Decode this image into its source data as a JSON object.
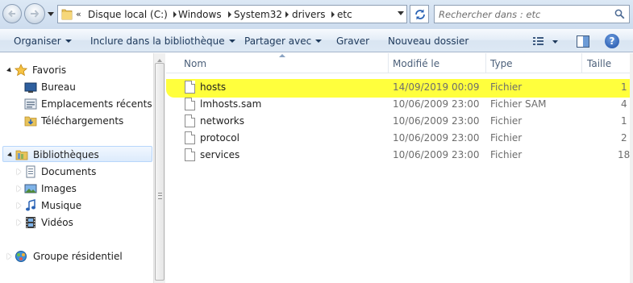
{
  "address": {
    "overflow": "«",
    "crumbs": [
      "Disque local (C:)",
      "Windows",
      "System32",
      "drivers",
      "etc"
    ]
  },
  "search": {
    "placeholder": "Rechercher dans : etc"
  },
  "toolbar": {
    "organize": "Organiser",
    "include": "Inclure dans la bibliothèque",
    "share": "Partager avec",
    "burn": "Graver",
    "new_folder": "Nouveau dossier",
    "help": "?"
  },
  "nav": {
    "favorites": "Favoris",
    "desktop": "Bureau",
    "recent": "Emplacements récents",
    "downloads": "Téléchargements",
    "libraries": "Bibliothèques",
    "documents": "Documents",
    "images": "Images",
    "music": "Musique",
    "videos": "Vidéos",
    "homegroup": "Groupe résidentiel"
  },
  "columns": {
    "name": "Nom",
    "modified": "Modifié le",
    "type": "Type",
    "size": "Taille"
  },
  "files": [
    {
      "name": "hosts",
      "modified": "14/09/2019 00:09",
      "type": "Fichier",
      "size": "1"
    },
    {
      "name": "lmhosts.sam",
      "modified": "10/06/2009 23:00",
      "type": "Fichier SAM",
      "size": "4"
    },
    {
      "name": "networks",
      "modified": "10/06/2009 23:00",
      "type": "Fichier",
      "size": "1"
    },
    {
      "name": "protocol",
      "modified": "10/06/2009 23:00",
      "type": "Fichier",
      "size": "2"
    },
    {
      "name": "services",
      "modified": "10/06/2009 23:00",
      "type": "Fichier",
      "size": "18"
    }
  ],
  "colors": {
    "highlight": "#ffff33",
    "toolbar_text": "#1e395b",
    "selected_nav": "#dcebfc"
  }
}
